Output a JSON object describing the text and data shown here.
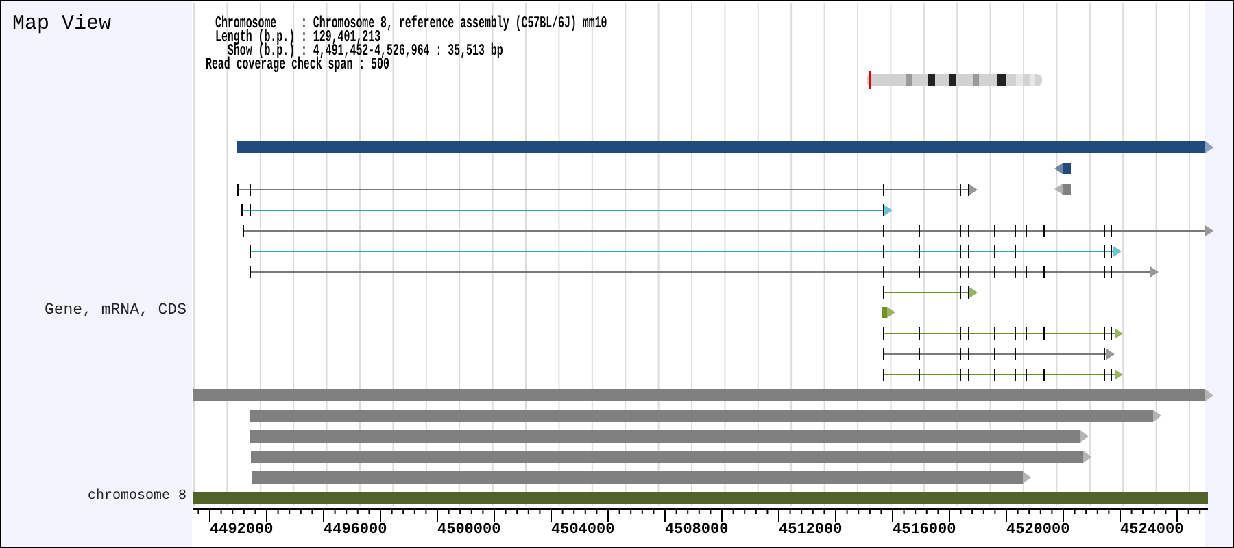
{
  "title": "Map View",
  "header_lines": [
    "Chromosome    : Chromosome 8, reference assembly (C57BL/6J) mm10",
    "Length (b.p.) : 129,401,213",
    "  Show (b.p.) : 4,491,452-4,526,964 : 35,513 bp"
  ],
  "coverage_line": "Read coverage check span : 500",
  "track_label": "Gene, mRNA, CDS",
  "chromosome_label": "chromosome 8",
  "axis_labels": [
    "4492000",
    "4496000",
    "4500000",
    "4504000",
    "4508000",
    "4512000",
    "4516000",
    "4520000",
    "4524000"
  ]
}
